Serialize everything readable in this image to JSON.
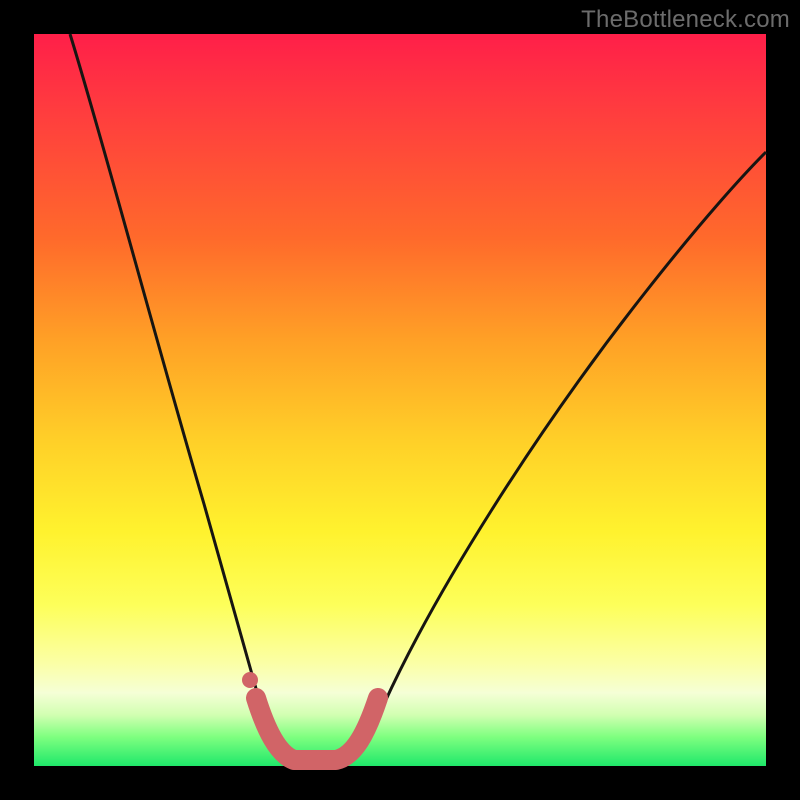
{
  "watermark": "TheBottleneck.com",
  "colors": {
    "frame": "#000000",
    "curve_stroke": "#171512",
    "marker_stroke": "#d16467",
    "marker_fill": "#d16467"
  },
  "chart_data": {
    "type": "line",
    "title": "",
    "xlabel": "",
    "ylabel": "",
    "xlim": [
      0,
      100
    ],
    "ylim": [
      0,
      100
    ],
    "grid": false,
    "legend": false,
    "note": "Axes are implicit (no tick labels shown). Values are estimated from pixel positions on a 0–100 normalized grid where y=0 is the bottom edge. The curve depicts a bottleneck-style V: steep descent on the left, near-zero minimum around x≈34–40, then a gentler rise to the right.",
    "series": [
      {
        "name": "bottleneck-curve",
        "x": [
          5,
          10,
          15,
          20,
          24,
          28,
          30,
          32,
          34,
          36,
          38,
          40,
          42,
          46,
          52,
          60,
          70,
          80,
          90,
          100
        ],
        "y": [
          100,
          85,
          68,
          50,
          34,
          18,
          10,
          4,
          1,
          0,
          0,
          1,
          3,
          9,
          19,
          32,
          46,
          57,
          66,
          72
        ]
      }
    ],
    "markers": {
      "name": "highlighted-valley-points",
      "x": [
        30,
        32,
        34,
        36,
        38,
        40,
        42,
        44
      ],
      "y": [
        8,
        3,
        1,
        0,
        0,
        1,
        3,
        6
      ]
    }
  }
}
